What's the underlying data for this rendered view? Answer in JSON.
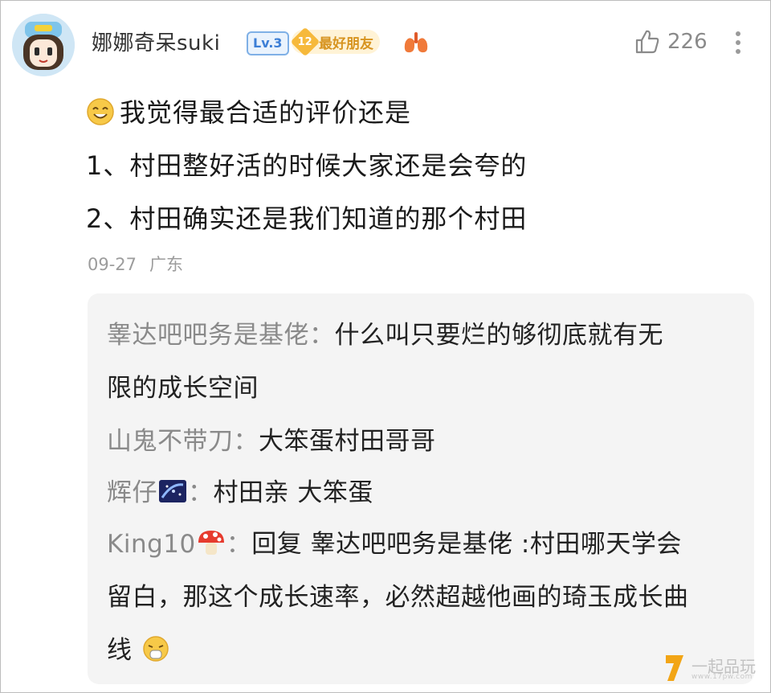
{
  "post": {
    "username": "娜娜奇呆suki",
    "level": "Lv.3",
    "friend_badge": {
      "level": "12",
      "label": "最好朋友"
    },
    "like_count": "226",
    "lines": [
      "我觉得最合适的评价还是",
      "1、村田整好活的时候大家还是会夸的",
      "2、村田确实还是我们知道的那个村田"
    ],
    "date": "09-27",
    "location": "广东"
  },
  "replies": [
    {
      "author": "睾达吧吧务是基佬",
      "sep": "：",
      "text_lines": [
        "什么叫只要烂的够彻底就有无",
        "限的成长空间"
      ]
    },
    {
      "author": "山鬼不带刀",
      "sep": "：",
      "text_lines": [
        "大笨蛋村田哥哥"
      ]
    },
    {
      "author": "辉仔",
      "sep": "：",
      "text_lines": [
        "村田亲 大笨蛋"
      ]
    },
    {
      "author": "King10",
      "sep": "：",
      "text_lines": [
        "回复 睾达吧吧务是基佬 :村田哪天学会",
        "留白，那这个成长速率，必然超越他画的琦玉成长曲",
        "线"
      ]
    }
  ],
  "watermark": {
    "text": "一起品玩",
    "url": "www.17pw.com"
  },
  "icons": {
    "avatar": "cartoon-girl-avatar",
    "lungs": "lungs-icon",
    "like": "thumbs-up-icon",
    "more": "more-vertical-icon",
    "smile": "smile-emoji",
    "galaxy": "galaxy-emoji",
    "mushroom": "mushroom-emoji",
    "sick": "sick-emoji"
  },
  "colors": {
    "accent_blue": "#3d7fd6",
    "friend_gold": "#d79420",
    "reply_bg": "#f4f4f4",
    "muted": "#9c9c9c"
  }
}
